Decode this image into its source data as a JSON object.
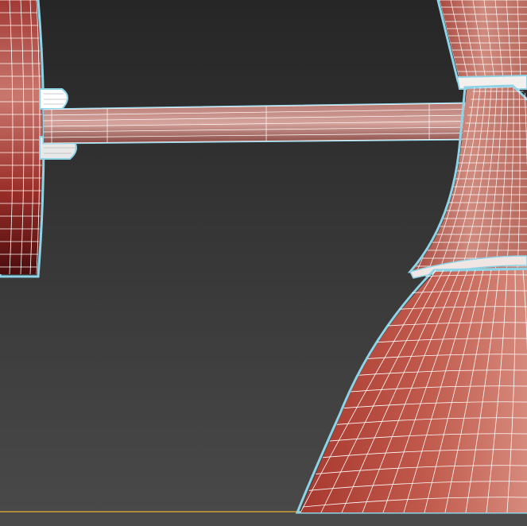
{
  "viewport": {
    "selection_outline_color": "#8fd3e6",
    "wireframe_color": "#ffffff",
    "ground_line_color": "#b08a3c",
    "background_colors": [
      "#2c2c2c",
      "#474747"
    ],
    "model_colors": {
      "disc": [
        "#7a1c1a",
        "#b5504a",
        "#c9776e"
      ],
      "rod": [
        "#9a4f4a",
        "#c58f88"
      ],
      "shade": [
        "#8a2a22",
        "#b54a3c",
        "#cf7a6c"
      ]
    }
  },
  "objects": [
    {
      "name": "wall-disc"
    },
    {
      "name": "arm-rod"
    },
    {
      "name": "lamp-shade"
    }
  ]
}
